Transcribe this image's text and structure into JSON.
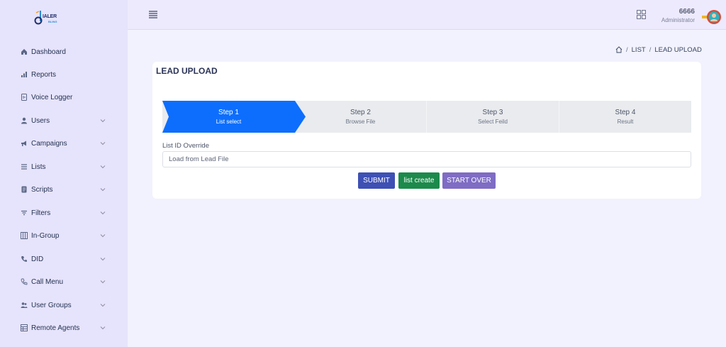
{
  "logo": {
    "text": "IALER",
    "subtext": "BLING"
  },
  "sidebar": {
    "items": [
      {
        "label": "Dashboard",
        "icon": "home-icon",
        "expandable": false
      },
      {
        "label": "Reports",
        "icon": "bar-chart-icon",
        "expandable": false
      },
      {
        "label": "Voice Logger",
        "icon": "document-audio-icon",
        "expandable": false
      },
      {
        "label": "Users",
        "icon": "user-icon",
        "expandable": true
      },
      {
        "label": "Campaigns",
        "icon": "megaphone-icon",
        "expandable": true
      },
      {
        "label": "Lists",
        "icon": "list-icon",
        "expandable": true
      },
      {
        "label": "Scripts",
        "icon": "script-icon",
        "expandable": true
      },
      {
        "label": "Filters",
        "icon": "filter-icon",
        "expandable": true
      },
      {
        "label": "In-Group",
        "icon": "columns-icon",
        "expandable": true
      },
      {
        "label": "DID",
        "icon": "phone-icon",
        "expandable": true
      },
      {
        "label": "Call Menu",
        "icon": "phone-outline-icon",
        "expandable": true
      },
      {
        "label": "User Groups",
        "icon": "users-icon",
        "expandable": true
      },
      {
        "label": "Remote Agents",
        "icon": "table-icon",
        "expandable": true
      }
    ]
  },
  "topbar": {
    "user_name": "6666",
    "user_role": "Administrator"
  },
  "breadcrumb": {
    "items": [
      "LIST",
      "LEAD UPLOAD"
    ]
  },
  "card": {
    "title": "LEAD UPLOAD",
    "steps": [
      {
        "title": "Step 1",
        "subtitle": "List select",
        "active": true
      },
      {
        "title": "Step 2",
        "subtitle": "Browse File",
        "active": false
      },
      {
        "title": "Step 3",
        "subtitle": "Select Feild",
        "active": false
      },
      {
        "title": "Step 4",
        "subtitle": "Result",
        "active": false
      }
    ],
    "field_label": "List ID Override",
    "field_placeholder": "Load from Lead File",
    "buttons": {
      "submit": "SUBMIT",
      "create": "list create",
      "start_over": "START OVER"
    }
  },
  "colors": {
    "sidebar_bg": "#e6e3fc",
    "page_bg": "#f1f2fd",
    "step_active": "#0d6efd",
    "submit": "#3e50b4",
    "create": "#1b8a4b",
    "start_over": "#7f6cc4"
  }
}
